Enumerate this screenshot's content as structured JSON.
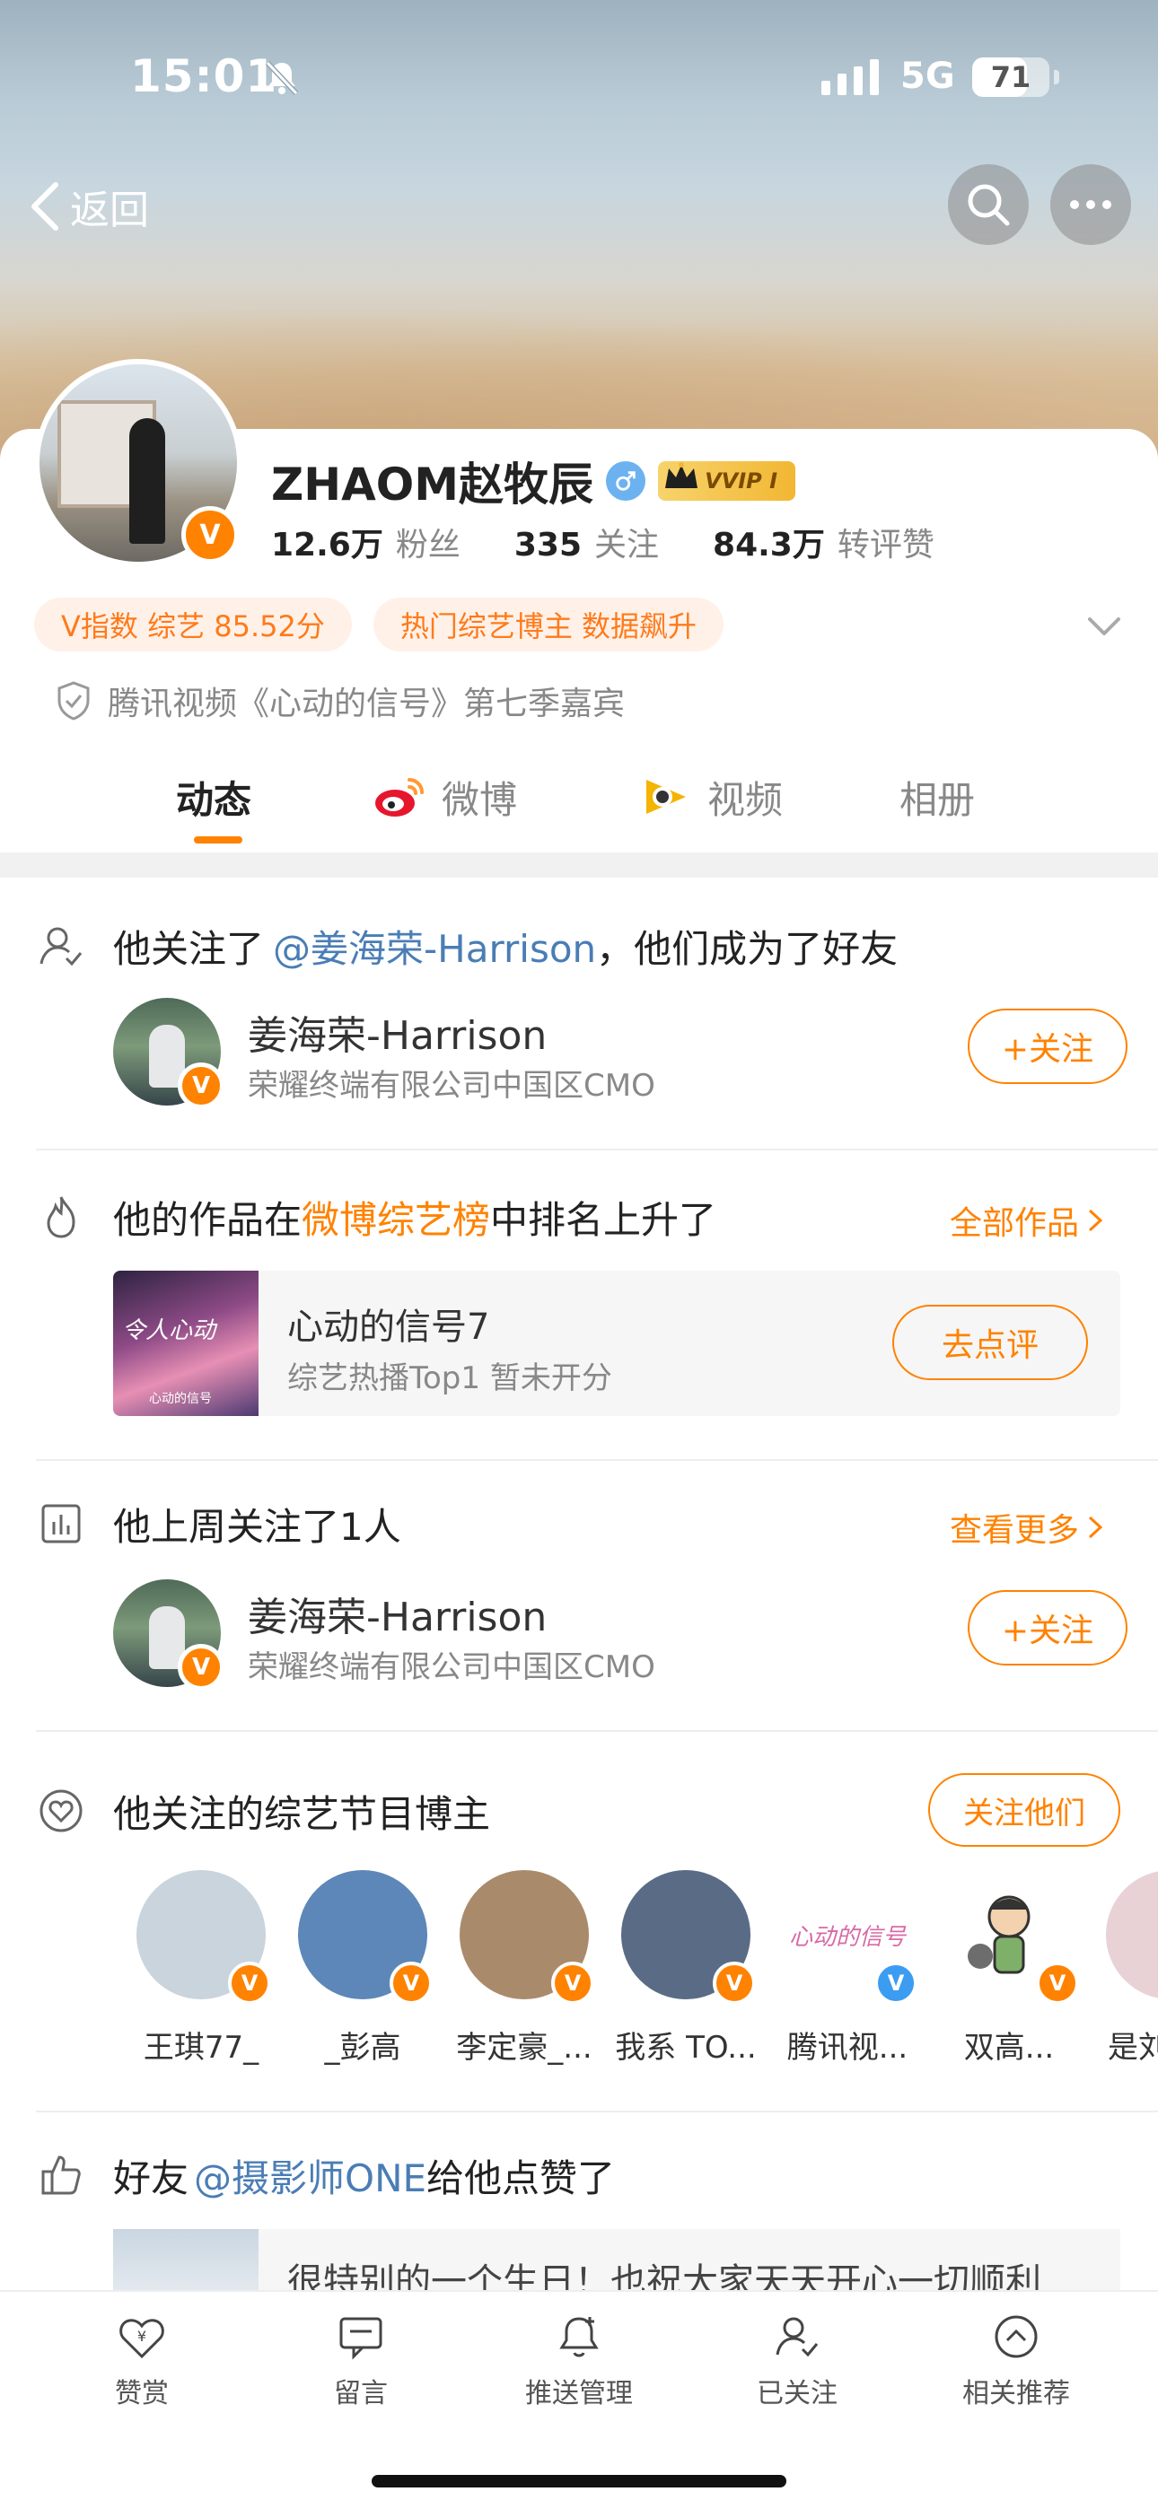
{
  "status_bar": {
    "time": "15:01",
    "network": "5G",
    "battery": "71",
    "battery_level": 0.71
  },
  "nav": {
    "back_label": "返回"
  },
  "profile": {
    "name": "ZHAOM赵牧辰",
    "vip_label": "VVIP I",
    "stats": [
      {
        "value": "12.6万",
        "label": "粉丝"
      },
      {
        "value": "335",
        "label": "关注"
      },
      {
        "value": "84.3万",
        "label": "转评赞"
      }
    ],
    "tags": [
      "V指数 综艺 85.52分",
      "热门综艺博主 数据飙升"
    ],
    "verification": "腾讯视频《心动的信号》第七季嘉宾",
    "badge": "V"
  },
  "tabs": [
    {
      "label": "动态"
    },
    {
      "label": "微博"
    },
    {
      "label": "视频"
    },
    {
      "label": "相册"
    }
  ],
  "feed": {
    "friend": {
      "prefix": "他关注了",
      "mention": "@姜海荣-Harrison",
      "suffix": "，他们成为了好友",
      "user": {
        "name": "姜海荣-Harrison",
        "desc": "荣耀终端有限公司中国区CMO",
        "button": "+关注"
      }
    },
    "rank": {
      "prefix": "他的作品在",
      "highlight": "微博综艺榜",
      "suffix": "中排名上升了",
      "more": "全部作品",
      "work": {
        "title": "心动的信号7",
        "sub": "综艺热播Top1 暂未开分",
        "button": "去点评",
        "poster_text": "令人心动",
        "poster_brand": "心动的信号"
      }
    },
    "weekly": {
      "title": "他上周关注了1人",
      "more": "查看更多",
      "user": {
        "name": "姜海荣-Harrison",
        "desc": "荣耀终端有限公司中国区CMO",
        "button": "+关注"
      }
    },
    "bloggers": {
      "title": "他关注的综艺节目博主",
      "button": "关注他们",
      "items": [
        {
          "name": "王琪77_",
          "color": "#c9d4dc"
        },
        {
          "name": "_彭高",
          "color": "#5d87b8"
        },
        {
          "name": "李定豪_...",
          "color": "#a98b6c"
        },
        {
          "name": "我系 TO...",
          "color": "#5a6b86"
        },
        {
          "name": "腾讯视...",
          "color": "#ffffff"
        },
        {
          "name": "双高...",
          "color": "#ffffff"
        },
        {
          "name": "是刘",
          "color": "#e9d2d6"
        }
      ]
    },
    "like": {
      "prefix": "好友",
      "mention": "@摄影师ONE",
      "suffix": "给他点赞了",
      "preview": "很特别的一个生日！也祝大家天天开心一切顺利"
    }
  },
  "bottom_bar": [
    {
      "label": "赞赏",
      "icon": "reward-icon"
    },
    {
      "label": "留言",
      "icon": "message-icon"
    },
    {
      "label": "推送管理",
      "icon": "push-bell-icon"
    },
    {
      "label": "已关注",
      "icon": "following-icon"
    },
    {
      "label": "相关推荐",
      "icon": "recommend-icon"
    }
  ],
  "colors": {
    "accent": "#ff8200",
    "link": "#4a7db5",
    "badge": "#ff8200"
  }
}
